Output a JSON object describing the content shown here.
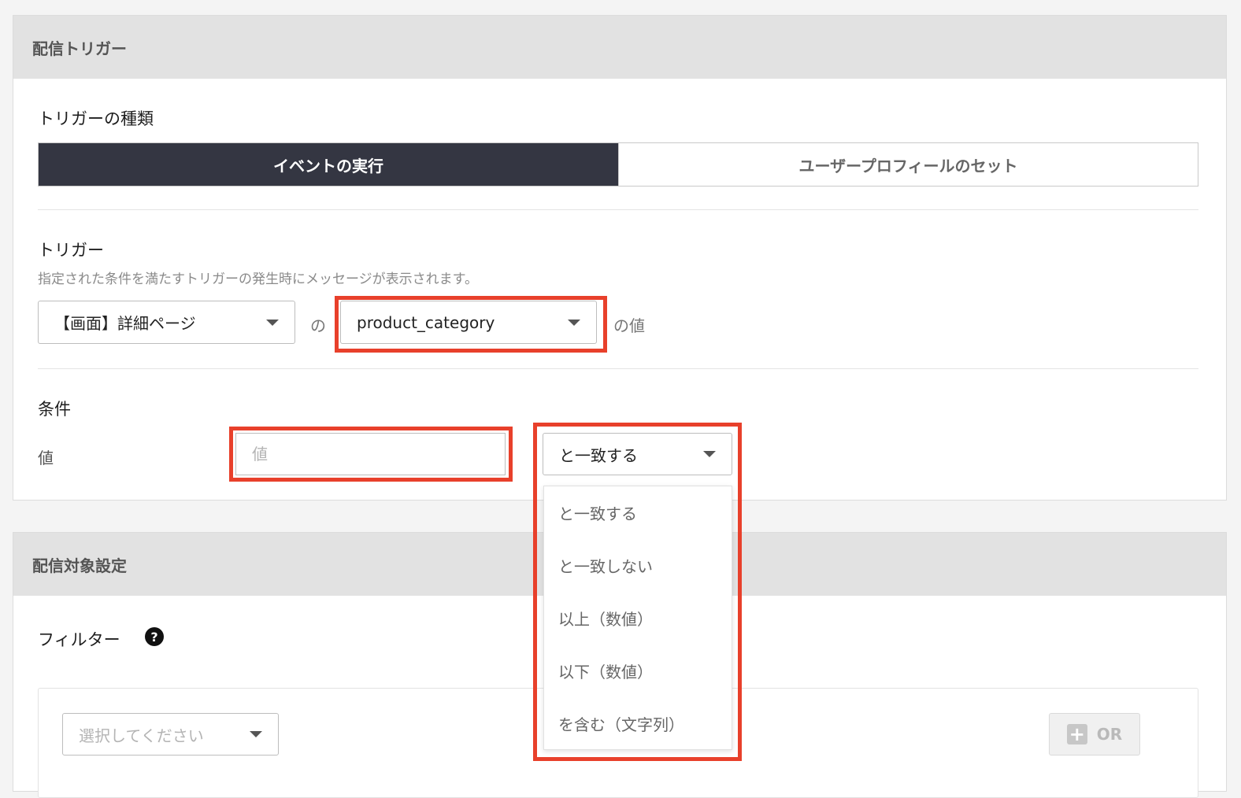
{
  "trigger_section": {
    "header": "配信トリガー",
    "trigger_type_label": "トリガーの種類",
    "trigger_type_options": [
      "イベントの実行",
      "ユーザープロフィールのセット"
    ],
    "trigger_label": "トリガー",
    "trigger_help": "指定された条件を満たすトリガーの発生時にメッセージが表示されます。",
    "event_select_value": "【画面】詳細ページ",
    "connector_no": "の",
    "property_select_value": "product_category",
    "value_suffix": "の値",
    "condition_label": "条件",
    "value_label": "値",
    "value_input_placeholder": "値",
    "operator_select_value": "と一致する",
    "operator_options": [
      "と一致する",
      "と一致しない",
      "以上（数値）",
      "以下（数値）",
      "を含む（文字列）"
    ]
  },
  "target_section": {
    "header": "配信対象設定",
    "filter_label": "フィルター",
    "help_icon_glyph": "?",
    "filter_select_placeholder": "選択してください",
    "or_button_label": "OR",
    "plus_glyph": "+"
  },
  "icons": {
    "help": "question-circle-icon",
    "caret": "caret-down-icon",
    "plus": "plus-square-icon"
  },
  "colors": {
    "active_tab_bg": "#343642",
    "highlight": "#e8402b",
    "section_header_bg": "#e2e2e2"
  }
}
